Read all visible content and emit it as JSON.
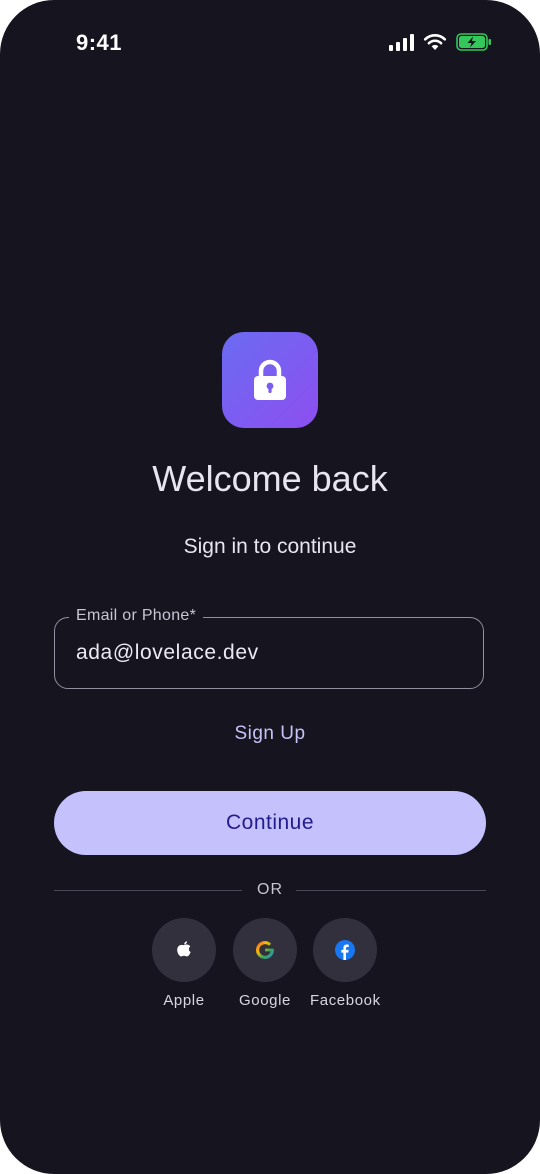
{
  "status_bar": {
    "time": "9:41",
    "signal_icon": "cellular-signal-icon",
    "wifi_icon": "wifi-icon",
    "battery_icon": "battery-charging-icon",
    "battery_color": "#34c759"
  },
  "app_icon": {
    "icon": "lock-icon",
    "gradient": [
      "#6b6bf2",
      "#8d4ff0"
    ]
  },
  "title": "Welcome back",
  "subtitle": "Sign in to continue",
  "email_field": {
    "label": "Email or Phone*",
    "value": "ada@lovelace.dev"
  },
  "signup_link": "Sign Up",
  "continue_button": {
    "label": "Continue",
    "bg": "#c4c1fd",
    "fg": "#241c8a"
  },
  "divider": {
    "label": "OR"
  },
  "social": [
    {
      "name": "Apple",
      "icon": "apple-icon"
    },
    {
      "name": "Google",
      "icon": "google-icon"
    },
    {
      "name": "Facebook",
      "icon": "facebook-icon",
      "color": "#1877f2"
    }
  ],
  "colors": {
    "background": "#15141f",
    "accent": "#c4c1fd"
  }
}
